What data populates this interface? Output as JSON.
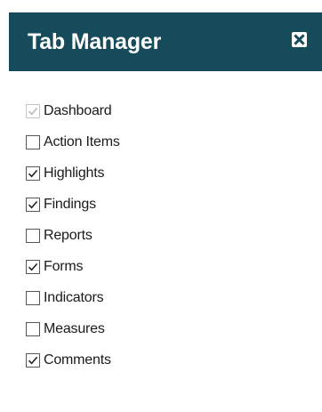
{
  "header": {
    "title": "Tab Manager",
    "close_icon": "close-icon",
    "background_color": "#154b5a"
  },
  "tabs": [
    {
      "label": "Dashboard",
      "checked": true,
      "disabled": true
    },
    {
      "label": "Action Items",
      "checked": false,
      "disabled": false
    },
    {
      "label": "Highlights",
      "checked": true,
      "disabled": false
    },
    {
      "label": "Findings",
      "checked": true,
      "disabled": false
    },
    {
      "label": "Reports",
      "checked": false,
      "disabled": false
    },
    {
      "label": "Forms",
      "checked": true,
      "disabled": false
    },
    {
      "label": "Indicators",
      "checked": false,
      "disabled": false
    },
    {
      "label": "Measures",
      "checked": false,
      "disabled": false
    },
    {
      "label": "Comments",
      "checked": true,
      "disabled": false
    }
  ]
}
